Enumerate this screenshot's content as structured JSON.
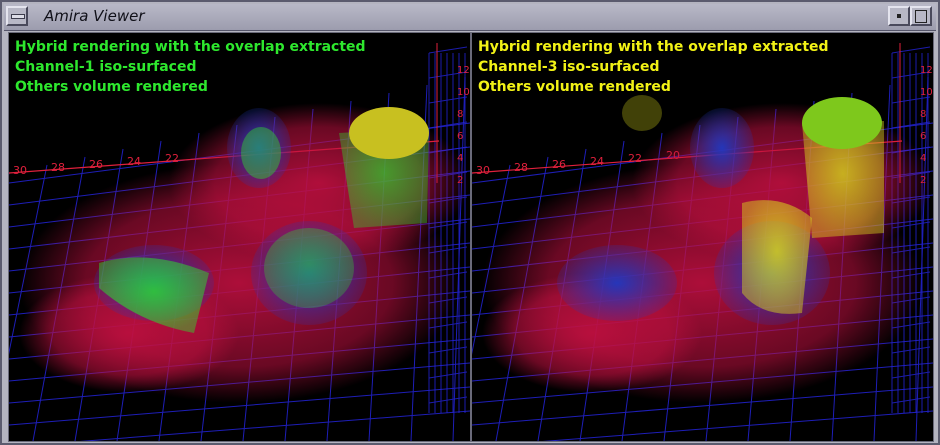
{
  "window": {
    "title": "Amira Viewer",
    "icons": {
      "menu": "window-menu-icon",
      "minimize": "minimize-icon",
      "maximize": "maximize-icon"
    }
  },
  "viewers": [
    {
      "lines": [
        "Hybrid rendering with the overlap extracted",
        "Channel-1 iso-surfaced",
        "Others volume rendered"
      ],
      "text_color": "#2ee82e",
      "iso_color": "#2ed62e",
      "axis_ticks": [
        "30",
        "28",
        "26",
        "24",
        "22"
      ],
      "vertical_ticks": [
        "2",
        "4",
        "6",
        "8",
        "10",
        "12"
      ]
    },
    {
      "lines": [
        "Hybrid rendering with the overlap extracted",
        "Channel-3 iso-surfaced",
        "Others volume rendered"
      ],
      "text_color": "#f2f216",
      "iso_color": "#d8d81c",
      "axis_ticks": [
        "30",
        "28",
        "26",
        "24",
        "22",
        "20"
      ],
      "vertical_ticks": [
        "2",
        "4",
        "6",
        "8",
        "10",
        "12"
      ]
    }
  ],
  "colors": {
    "grid": "#2424d8",
    "volume_red": "#c01040",
    "volume_blue": "#2038c0",
    "axis_red": "#e0203c"
  }
}
